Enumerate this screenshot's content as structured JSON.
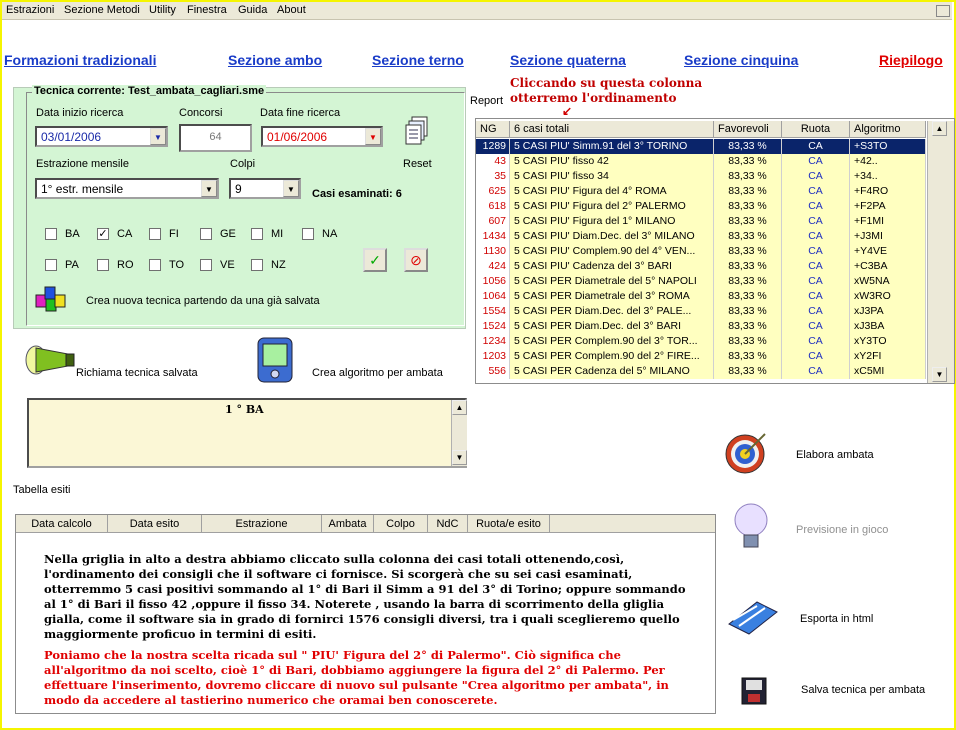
{
  "menu": [
    "Estrazioni",
    "Sezione Metodi",
    "Utility",
    "Finestra",
    "Guida",
    "About"
  ],
  "nav": {
    "trad": "Formazioni tradizionali",
    "ambo": "Sezione ambo",
    "terno": "Sezione terno",
    "quaterna": "Sezione quaterna",
    "cinquina": "Sezione cinquina",
    "riepilogo": "Riepilogo"
  },
  "form": {
    "title": "Tecnica corrente: Test_ambata_cagliari.sme",
    "start_label": "Data inizio ricerca",
    "start_value": "03/01/2006",
    "concorsi_label": "Concorsi",
    "concorsi_value": "64",
    "end_label": "Data fine ricerca",
    "end_value": "01/06/2006",
    "estr_label": "Estrazione mensile",
    "estr_value": "1° estr. mensile",
    "colpi_label": "Colpi",
    "colpi_value": "9",
    "reset_label": "Reset",
    "casi_label": "Casi esaminati: 6",
    "wheels_row1": [
      "BA",
      "CA",
      "FI",
      "GE",
      "MI",
      "NA"
    ],
    "wheels_row2": [
      "PA",
      "RO",
      "TO",
      "VE",
      "NZ"
    ],
    "checked_wheel": "CA",
    "checkmark": "✓",
    "ok_glyph": "✓",
    "cancel_glyph": "⊘",
    "new_from_saved": "Crea nuova tecnica partendo da una già salvata"
  },
  "report_label": "Report",
  "annotation": "Cliccando su questa colonna\notterremo l'ordinamento",
  "grid": {
    "headers": [
      "NG",
      "6 casi totali",
      "Favorevoli",
      "Ruota",
      "Algoritmo"
    ],
    "rows": [
      [
        "1289",
        "5 CASI PIU' Simm.91 del 3° TORINO",
        "83,33 %",
        "CA",
        "+S3TO"
      ],
      [
        "43",
        "5 CASI PIU' fisso 42",
        "83,33 %",
        "CA",
        "+42.."
      ],
      [
        "35",
        "5 CASI PIU' fisso 34",
        "83,33 %",
        "CA",
        "+34.."
      ],
      [
        "625",
        "5 CASI PIU' Figura del 4° ROMA",
        "83,33 %",
        "CA",
        "+F4RO"
      ],
      [
        "618",
        "5 CASI PIU' Figura del 2° PALERMO",
        "83,33 %",
        "CA",
        "+F2PA"
      ],
      [
        "607",
        "5 CASI PIU' Figura del 1° MILANO",
        "83,33 %",
        "CA",
        "+F1MI"
      ],
      [
        "1434",
        "5 CASI PIU' Diam.Dec. del 3° MILANO",
        "83,33 %",
        "CA",
        "+J3MI"
      ],
      [
        "1130",
        "5 CASI PIU' Complem.90 del 4° VEN...",
        "83,33 %",
        "CA",
        "+Y4VE"
      ],
      [
        "424",
        "5 CASI PIU' Cadenza del 3° BARI",
        "83,33 %",
        "CA",
        "+C3BA"
      ],
      [
        "1056",
        "5 CASI PER Diametrale del 5° NAPOLI",
        "83,33 %",
        "CA",
        "xW5NA"
      ],
      [
        "1064",
        "5 CASI PER Diametrale del 3° ROMA",
        "83,33 %",
        "CA",
        "xW3RO"
      ],
      [
        "1554",
        "5 CASI PER Diam.Dec. del 3° PALE...",
        "83,33 %",
        "CA",
        "xJ3PA"
      ],
      [
        "1524",
        "5 CASI PER Diam.Dec. del 3° BARI",
        "83,33 %",
        "CA",
        "xJ3BA"
      ],
      [
        "1234",
        "5 CASI PER Complem.90 del 3° TOR...",
        "83,33 %",
        "CA",
        "xY3TO"
      ],
      [
        "1203",
        "5 CASI PER Complem.90 del 2° FIRE...",
        "83,33 %",
        "CA",
        "xY2FI"
      ],
      [
        "556",
        "5 CASI PER Cadenza del 5° MILANO",
        "83,33 %",
        "CA",
        "xC5MI"
      ]
    ]
  },
  "actions": {
    "richiama": "Richiama tecnica salvata",
    "crea_algoritmo": "Crea algoritmo per ambata",
    "elabora": "Elabora ambata",
    "previsione": "Previsione in gioco",
    "esporta": "Esporta in html",
    "salva": "Salva tecnica per ambata"
  },
  "algo_text": "1 ° BA",
  "tabella_label": "Tabella esiti",
  "results_headers": [
    "Data calcolo",
    "Data esito",
    "Estrazione",
    "Ambata",
    "Colpo",
    "NdC",
    "Ruota/e esito"
  ],
  "explain": {
    "p1": "Nella griglia in alto a destra abbiamo cliccato sulla colonna dei casi totali  ottenendo,così, l'ordinamento dei consigli che il software ci fornisce. Si scorgerà che su sei casi esaminati, otterremmo 5 casi positivi sommando al 1° di Bari il Simm a 91 del 3° di Torino; oppure sommando al 1° di Bari il fisso 42 ,oppure il fisso 34. Noterete , usando la barra di scorrimento della gliglia gialla, come il software sia in grado di fornirci  1576 consigli diversi, tra i quali sceglieremo quello maggiormente proficuo in termini di esiti.",
    "p2": "Poniamo che la nostra scelta ricada sul \" PIU' Figura del 2° di Palermo\". Ciò significa che all'algoritmo da noi scelto, cioè 1° di Bari, dobbiamo aggiungere la figura del 2° di Palermo. Per effettuare l'inserimento, dovremo cliccare di nuovo sul pulsante \"Crea algoritmo per ambata\", in modo da accedere al tastierino numerico che oramai ben conoscerete."
  },
  "colors": {
    "panel_green": "#d4f5d4",
    "row_yellow": "#ffffc0",
    "selected_row": "#0a246a",
    "link_blue": "#1a3cc8",
    "link_red": "#e00000",
    "ng_red": "#d00000"
  }
}
